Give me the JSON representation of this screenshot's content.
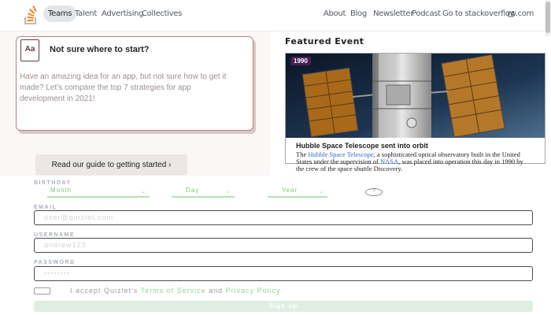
{
  "nav": {
    "items": [
      "Teams",
      "Talent",
      "Advertising",
      "Collectives"
    ],
    "right_items": [
      "About",
      "Blog",
      "Newsletter",
      "Podcast",
      "Go to stackoverflow.com"
    ],
    "external_icon": "external-link-icon"
  },
  "card": {
    "icon_text": "Aa",
    "title": "Not sure where to start?",
    "description": "Have an amazing idea for an app, but not sure how to get it made? Let’s compare the top 7 strategies for app development in 2021!",
    "button_label": "Read our guide to getting started ›"
  },
  "featured": {
    "heading": "Featured Event",
    "year": "1990",
    "title": "Hubble Space Telescope sent into orbit",
    "desc_parts": [
      "The ",
      "Hubble Space Telescope",
      ", a sophisticated optical observatory built in the United States under the supervision of ",
      "NASA",
      ", was placed into operation this day in 1990 by the crew of the space shuttle Discovery."
    ]
  },
  "form": {
    "birthday_label": "BIRTHDAY",
    "month": "Month",
    "day": "Day",
    "year": "Year",
    "help": "?",
    "email_label": "EMAIL",
    "email_placeholder": "user@quizlet.com",
    "username_label": "USERNAME",
    "username_placeholder": "andrew123",
    "password_label": "PASSWORD",
    "password_placeholder": "••••••••",
    "terms": [
      "I accept Quizlet's ",
      "Terms of Service",
      " and ",
      "Privacy Policy"
    ],
    "signup_label": "Sign up"
  },
  "colors": {
    "accent_green": "#8ed88e",
    "badge_purple": "#4a1e54",
    "card_border": "#b48484"
  }
}
